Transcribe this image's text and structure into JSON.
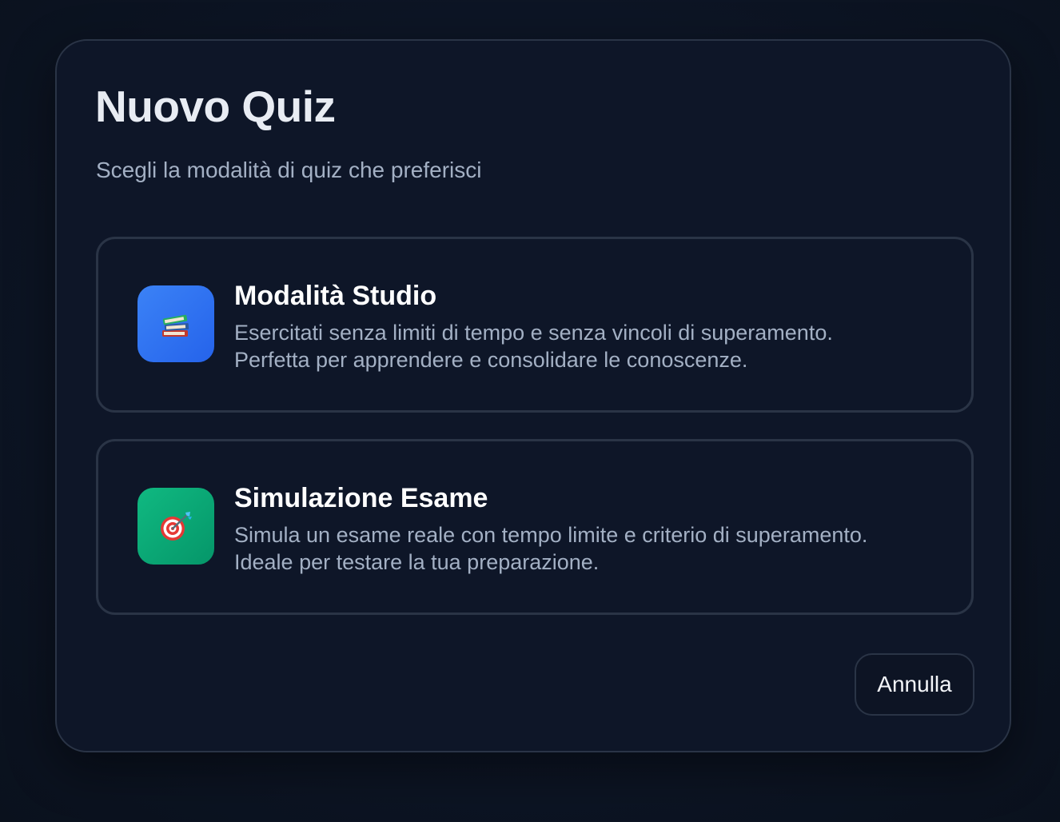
{
  "dialog": {
    "title": "Nuovo Quiz",
    "subtitle": "Scegli la modalità di quiz che preferisci"
  },
  "options": [
    {
      "icon": "books-icon",
      "icon_color": "#3b82f6",
      "title": "Modalità Studio",
      "description_line1": "Esercitati senza limiti di tempo e senza vincoli di superamento.",
      "description_line2": "Perfetta per apprendere e consolidare le conoscenze."
    },
    {
      "icon": "target-dart-icon",
      "icon_color": "#10b981",
      "title": "Simulazione Esame",
      "description_line1": "Simula un esame reale con tempo limite e criterio di superamento.",
      "description_line2": "Ideale per testare la tua preparazione."
    }
  ],
  "actions": {
    "cancel_label": "Annulla"
  },
  "colors": {
    "background": "#0b1220",
    "dialog": "#0e1628",
    "border": "#2a3446",
    "title_text": "#e8ecf3",
    "muted_text": "#a3b0c4"
  }
}
